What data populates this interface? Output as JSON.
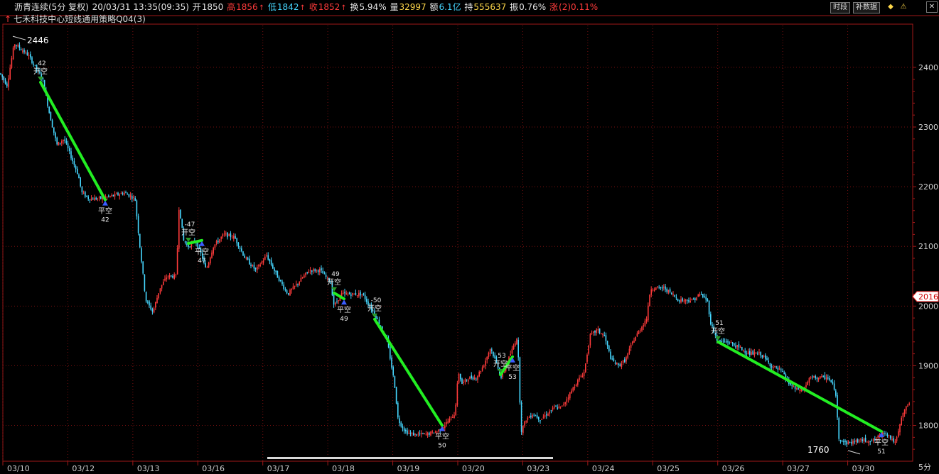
{
  "header": {
    "symbol": "沥青连续(5分 复权)",
    "datetime": "20/03/31 13:35(09:35)",
    "open_label": "开",
    "open_value": "1850",
    "high_label": "高",
    "high_value": "1856",
    "low_label": "低",
    "low_value": "1842",
    "close_label": "收",
    "close_value": "1852",
    "turnover_label": "换",
    "turnover_value": "5.94%",
    "volume_label": "量",
    "volume_value": "32997",
    "amount_label": "额",
    "amount_value": "6.1亿",
    "oi_label": "持",
    "oi_value": "555637",
    "amp_label": "振",
    "amp_value": "0.76%",
    "chg_label": "涨",
    "chg_value": "(2)0.11%"
  },
  "strategy_label": "七禾科技中心短线通用策略Q04(3)",
  "toolbar": {
    "timeshare": "时段",
    "supplement": "补数据"
  },
  "period_label": "5分",
  "colors": {
    "up": "#ff3b3b",
    "down": "#46d7ff",
    "signal_line": "#22ee22",
    "grid": "#7a1010",
    "axis": "#a01818"
  },
  "chart_data": {
    "type": "candlestick",
    "ylim": [
      1740,
      2470
    ],
    "yticks": [
      1800,
      1900,
      2000,
      2100,
      2200,
      2300,
      2400
    ],
    "current_price": 2016,
    "high_label": "2446",
    "low_label": "1760",
    "dates": [
      "03/10",
      "03/12",
      "03/13",
      "03/16",
      "03/17",
      "03/18",
      "03/19",
      "03/20",
      "03/23",
      "03/24",
      "03/25",
      "03/26",
      "03/27",
      "03/30"
    ],
    "path": [
      [
        0,
        2390
      ],
      [
        10,
        2370
      ],
      [
        20,
        2440
      ],
      [
        30,
        2430
      ],
      [
        40,
        2420
      ],
      [
        50,
        2400
      ],
      [
        60,
        2380
      ],
      [
        70,
        2320
      ],
      [
        80,
        2270
      ],
      [
        90,
        2280
      ],
      [
        100,
        2250
      ],
      [
        110,
        2220
      ],
      [
        115,
        2190
      ],
      [
        125,
        2180
      ],
      [
        140,
        2180
      ],
      [
        160,
        2185
      ],
      [
        175,
        2190
      ],
      [
        190,
        2180
      ],
      [
        195,
        2120
      ],
      [
        205,
        2010
      ],
      [
        215,
        1990
      ],
      [
        225,
        2030
      ],
      [
        235,
        2050
      ],
      [
        248,
        2050
      ],
      [
        252,
        2170
      ],
      [
        258,
        2110
      ],
      [
        265,
        2100
      ],
      [
        275,
        2110
      ],
      [
        285,
        2080
      ],
      [
        290,
        2060
      ],
      [
        300,
        2100
      ],
      [
        315,
        2120
      ],
      [
        330,
        2115
      ],
      [
        345,
        2080
      ],
      [
        360,
        2060
      ],
      [
        375,
        2085
      ],
      [
        390,
        2050
      ],
      [
        405,
        2020
      ],
      [
        420,
        2040
      ],
      [
        435,
        2060
      ],
      [
        450,
        2060
      ],
      [
        465,
        2040
      ],
      [
        470,
        2000
      ],
      [
        480,
        2020
      ],
      [
        495,
        2020
      ],
      [
        510,
        2020
      ],
      [
        520,
        2000
      ],
      [
        530,
        1980
      ],
      [
        545,
        1940
      ],
      [
        555,
        1870
      ],
      [
        560,
        1810
      ],
      [
        570,
        1790
      ],
      [
        580,
        1785
      ],
      [
        600,
        1785
      ],
      [
        615,
        1790
      ],
      [
        625,
        1800
      ],
      [
        640,
        1820
      ],
      [
        645,
        1890
      ],
      [
        650,
        1870
      ],
      [
        660,
        1880
      ],
      [
        670,
        1880
      ],
      [
        680,
        1900
      ],
      [
        690,
        1930
      ],
      [
        700,
        1900
      ],
      [
        705,
        1880
      ],
      [
        715,
        1910
      ],
      [
        728,
        1950
      ],
      [
        733,
        1790
      ],
      [
        740,
        1810
      ],
      [
        750,
        1820
      ],
      [
        760,
        1810
      ],
      [
        770,
        1820
      ],
      [
        780,
        1830
      ],
      [
        790,
        1830
      ],
      [
        800,
        1850
      ],
      [
        810,
        1870
      ],
      [
        822,
        1890
      ],
      [
        830,
        1950
      ],
      [
        840,
        1960
      ],
      [
        850,
        1950
      ],
      [
        860,
        1910
      ],
      [
        870,
        1900
      ],
      [
        880,
        1910
      ],
      [
        890,
        1940
      ],
      [
        900,
        1960
      ],
      [
        910,
        1980
      ],
      [
        915,
        2030
      ],
      [
        925,
        2030
      ],
      [
        935,
        2030
      ],
      [
        945,
        2020
      ],
      [
        955,
        2010
      ],
      [
        965,
        2010
      ],
      [
        975,
        2010
      ],
      [
        985,
        2020
      ],
      [
        995,
        2010
      ],
      [
        1000,
        1970
      ],
      [
        1010,
        1940
      ],
      [
        1025,
        1940
      ],
      [
        1040,
        1930
      ],
      [
        1055,
        1920
      ],
      [
        1070,
        1920
      ],
      [
        1085,
        1900
      ],
      [
        1100,
        1890
      ],
      [
        1110,
        1870
      ],
      [
        1120,
        1860
      ],
      [
        1130,
        1860
      ],
      [
        1140,
        1880
      ],
      [
        1155,
        1880
      ],
      [
        1165,
        1880
      ],
      [
        1175,
        1860
      ],
      [
        1180,
        1780
      ],
      [
        1190,
        1770
      ],
      [
        1210,
        1775
      ],
      [
        1230,
        1775
      ],
      [
        1245,
        1790
      ],
      [
        1260,
        1770
      ],
      [
        1270,
        1820
      ],
      [
        1280,
        1840
      ]
    ],
    "signals": [
      {
        "x1": 57,
        "y1": 2375,
        "x2": 148,
        "y2": 2178,
        "open_label": "开空",
        "open_qty": "42",
        "close_label": "平空",
        "close_qty": "42"
      },
      {
        "x1": 265,
        "y1": 2105,
        "x2": 284,
        "y2": 2110,
        "open_label": "开空",
        "open_qty": "-47",
        "close_label": "平空",
        "close_qty": "47"
      },
      {
        "x1": 470,
        "y1": 2022,
        "x2": 484,
        "y2": 2012,
        "open_label": "开空",
        "open_qty": "49",
        "close_label": "平空",
        "close_qty": "49"
      },
      {
        "x1": 527,
        "y1": 1978,
        "x2": 622,
        "y2": 1800,
        "open_label": "开空",
        "open_qty": "-50",
        "close_label": "平空",
        "close_qty": "50"
      },
      {
        "x1": 704,
        "y1": 1885,
        "x2": 721,
        "y2": 1915,
        "open_label": "开空",
        "open_qty": "53",
        "close_label": "平空",
        "close_qty": "53"
      },
      {
        "x1": 1010,
        "y1": 1940,
        "x2": 1240,
        "y2": 1790,
        "open_label": "开空",
        "open_qty": "51",
        "close_label": "平空",
        "close_qty": "51"
      }
    ]
  }
}
